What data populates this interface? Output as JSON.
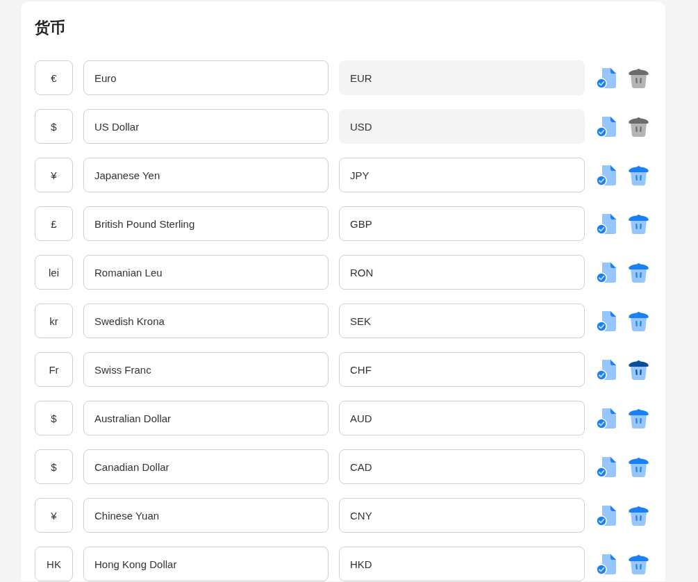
{
  "title": "货币",
  "currencies": [
    {
      "symbol": "€",
      "name": "Euro",
      "code": "EUR",
      "code_disabled": true,
      "delete_disabled": true,
      "delete_hovered": false
    },
    {
      "symbol": "$",
      "name": "US Dollar",
      "code": "USD",
      "code_disabled": true,
      "delete_disabled": true,
      "delete_hovered": false
    },
    {
      "symbol": "¥",
      "name": "Japanese Yen",
      "code": "JPY",
      "code_disabled": false,
      "delete_disabled": false,
      "delete_hovered": false
    },
    {
      "symbol": "£",
      "name": "British Pound Sterling",
      "code": "GBP",
      "code_disabled": false,
      "delete_disabled": false,
      "delete_hovered": false
    },
    {
      "symbol": "lei",
      "name": "Romanian Leu",
      "code": "RON",
      "code_disabled": false,
      "delete_disabled": false,
      "delete_hovered": false
    },
    {
      "symbol": "kr",
      "name": "Swedish Krona",
      "code": "SEK",
      "code_disabled": false,
      "delete_disabled": false,
      "delete_hovered": false
    },
    {
      "symbol": "Fr",
      "name": "Swiss Franc",
      "code": "CHF",
      "code_disabled": false,
      "delete_disabled": false,
      "delete_hovered": true
    },
    {
      "symbol": "$",
      "name": "Australian Dollar",
      "code": "AUD",
      "code_disabled": false,
      "delete_disabled": false,
      "delete_hovered": false
    },
    {
      "symbol": "$",
      "name": "Canadian Dollar",
      "code": "CAD",
      "code_disabled": false,
      "delete_disabled": false,
      "delete_hovered": false
    },
    {
      "symbol": "¥",
      "name": "Chinese Yuan",
      "code": "CNY",
      "code_disabled": false,
      "delete_disabled": false,
      "delete_hovered": false
    },
    {
      "symbol": "HK",
      "name": "Hong Kong Dollar",
      "code": "HKD",
      "code_disabled": false,
      "delete_disabled": false,
      "delete_hovered": false
    }
  ]
}
